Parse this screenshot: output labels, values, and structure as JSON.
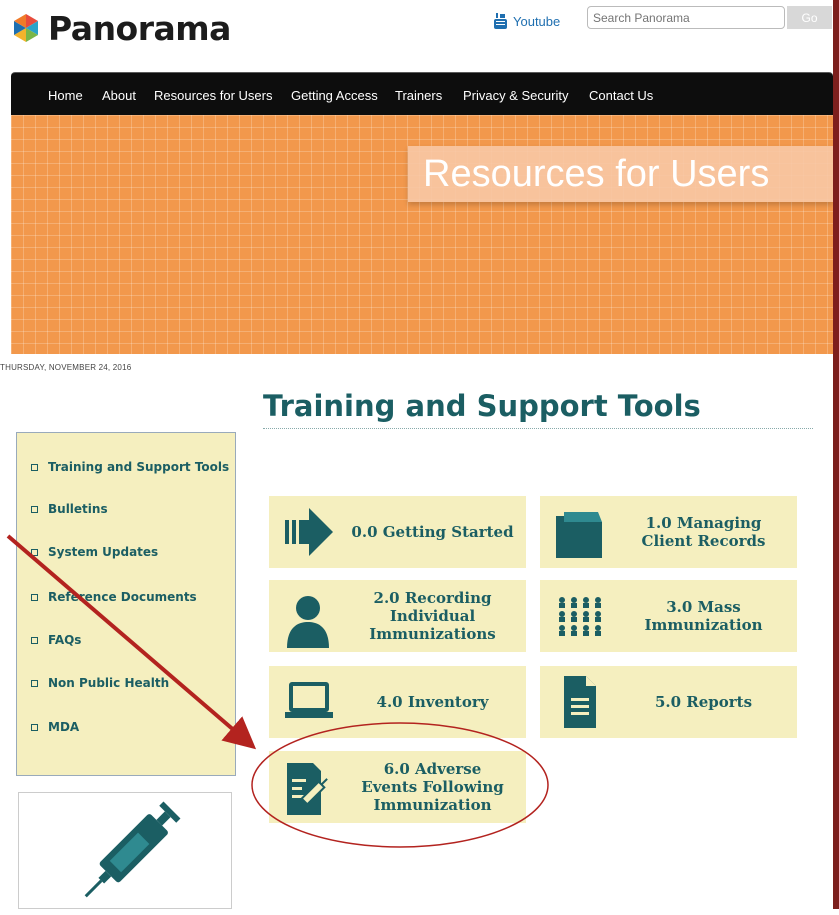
{
  "header": {
    "site_name": "Panorama",
    "youtube_label": "Youtube",
    "search_placeholder": "Search Panorama",
    "go_label": "Go"
  },
  "nav": {
    "items": [
      "Home",
      "About",
      "Resources for Users",
      "Getting Access",
      "Trainers",
      "Privacy & Security",
      "Contact Us"
    ]
  },
  "banner": {
    "title": "Resources for Users"
  },
  "date": "THURSDAY, NOVEMBER 24, 2016",
  "main": {
    "title": "Training and Support Tools"
  },
  "sidebar": {
    "items": [
      "Training and Support Tools",
      "Bulletins",
      "System Updates",
      "Reference Documents",
      "FAQs",
      "Non Public Health",
      "MDA"
    ]
  },
  "tiles": [
    {
      "lines": [
        "0.0 Getting Started"
      ],
      "icon": "arrow-right-icon"
    },
    {
      "lines": [
        "1.0 Managing",
        "Client Records"
      ],
      "icon": "folder-icon"
    },
    {
      "lines": [
        "2.0 Recording",
        "Individual",
        "Immunizations"
      ],
      "icon": "person-icon"
    },
    {
      "lines": [
        "3.0 Mass",
        "Immunization"
      ],
      "icon": "group-icon"
    },
    {
      "lines": [
        "4.0 Inventory"
      ],
      "icon": "laptop-icon"
    },
    {
      "lines": [
        "5.0 Reports"
      ],
      "icon": "document-icon"
    },
    {
      "lines": [
        "6.0 Adverse",
        "Events Following",
        "Immunization"
      ],
      "icon": "syringe-form-icon"
    }
  ],
  "colors": {
    "accent": "#1b5e63",
    "banner": "#f2984c",
    "tile_bg": "#f5efbf",
    "annotation": "#b3231f"
  }
}
